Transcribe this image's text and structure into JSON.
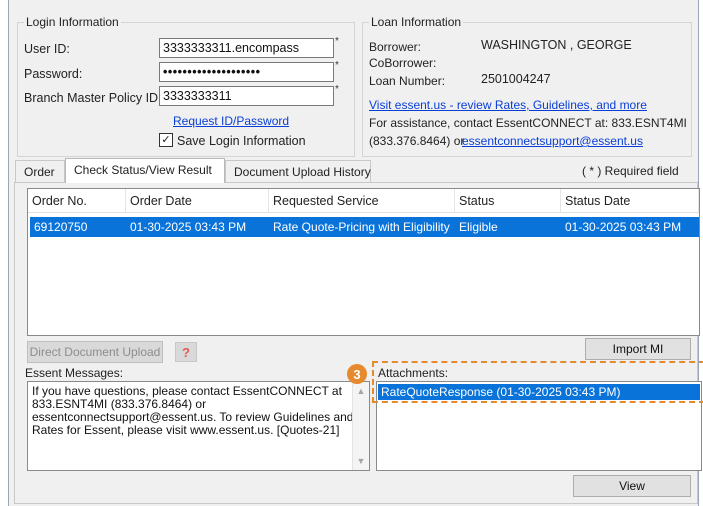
{
  "login": {
    "group_title": "Login Information",
    "user_id_label": "User ID:",
    "user_id_value": "3333333311.encompass",
    "password_label": "Password:",
    "password_value": "••••••••••••••••••••",
    "branch_label": "Branch Master Policy ID:",
    "branch_value": "3333333311",
    "request_link": "Request ID/Password",
    "save_label": "Save Login Information",
    "save_checked": "✓",
    "required_mark": "*"
  },
  "loan": {
    "group_title": "Loan Information",
    "borrower_label": "Borrower:",
    "borrower_value": "WASHINGTON , GEORGE",
    "coborrower_label": "CoBorrower:",
    "loan_number_label": "Loan Number:",
    "loan_number_value": "2501004247",
    "essent_link": "Visit essent.us - review Rates, Guidelines, and more",
    "assist_text": "For assistance, contact EssentCONNECT at: 833.ESNT4MI",
    "assist_phone": "(833.376.8464) or ",
    "assist_email": "essentconnectsupport@essent.us"
  },
  "tabs": {
    "order": "Order",
    "check_status": "Check Status/View Result",
    "upload_history": "Document Upload History",
    "required_note": "( * ) Required field"
  },
  "table": {
    "headers": [
      "Order No.",
      "Order Date",
      "Requested Service",
      "Status",
      "Status Date"
    ],
    "rows": [
      [
        "69120750",
        "01-30-2025 03:43 PM",
        "Rate Quote-Pricing with Eligibility",
        "Eligible",
        "01-30-2025 03:43 PM"
      ]
    ]
  },
  "buttons": {
    "direct_upload": "Direct Document Upload",
    "help": "?",
    "import_mi": "Import MI",
    "view": "View"
  },
  "messages": {
    "label": "Essent Messages:",
    "lines": [
      "If you have questions, please contact EssentCONNECT at",
      "833.ESNT4MI (833.376.8464) or",
      "essentconnectsupport@essent.us. To review Guidelines and",
      "Rates for Essent, please visit www.essent.us.  [Quotes-21]"
    ]
  },
  "attachments": {
    "label": "Attachments:",
    "items": [
      "RateQuoteResponse (01-30-2025 03:43 PM)"
    ]
  },
  "annotation": {
    "step_number": "3",
    "color": "#e58a2e"
  },
  "colors": {
    "selection": "#0a73d9",
    "link": "#0a3fd6"
  }
}
